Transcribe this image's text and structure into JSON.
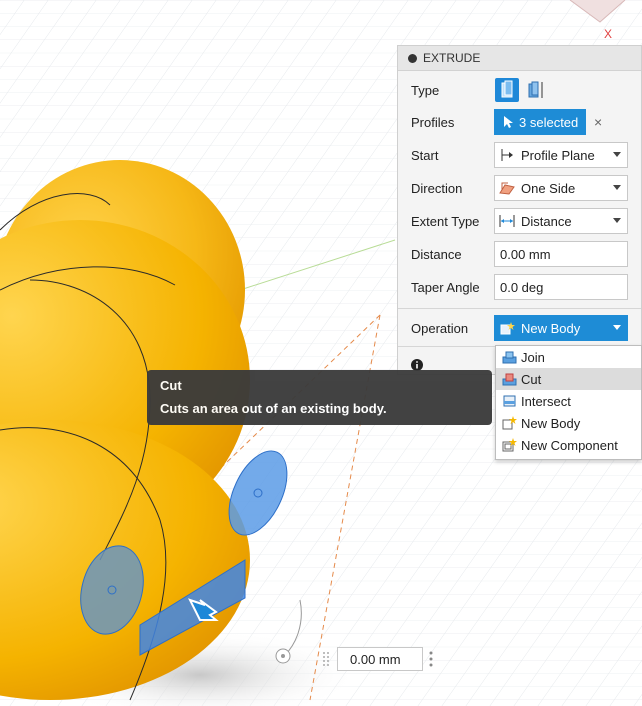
{
  "panel": {
    "title": "EXTRUDE",
    "rows": {
      "type": {
        "label": "Type"
      },
      "profiles": {
        "label": "Profiles",
        "value": "3 selected",
        "clear": "×"
      },
      "start": {
        "label": "Start",
        "value": "Profile Plane"
      },
      "direction": {
        "label": "Direction",
        "value": "One Side"
      },
      "extent_type": {
        "label": "Extent Type",
        "value": "Distance"
      },
      "distance": {
        "label": "Distance",
        "value": "0.00 mm"
      },
      "taper_angle": {
        "label": "Taper Angle",
        "value": "0.0 deg"
      },
      "operation": {
        "label": "Operation",
        "value": "New Body"
      }
    }
  },
  "operation_menu": {
    "items": [
      "Join",
      "Cut",
      "Intersect",
      "New Body",
      "New Component"
    ],
    "hovered": "Cut"
  },
  "tooltip": {
    "title": "Cut",
    "description": "Cuts an area out of an existing body."
  },
  "canvas": {
    "distance_input": "0.00 mm",
    "axis_label": "X"
  },
  "colors": {
    "accent": "#1e8cd6",
    "body": "#f5b800",
    "profile": "#4a8ee8"
  }
}
